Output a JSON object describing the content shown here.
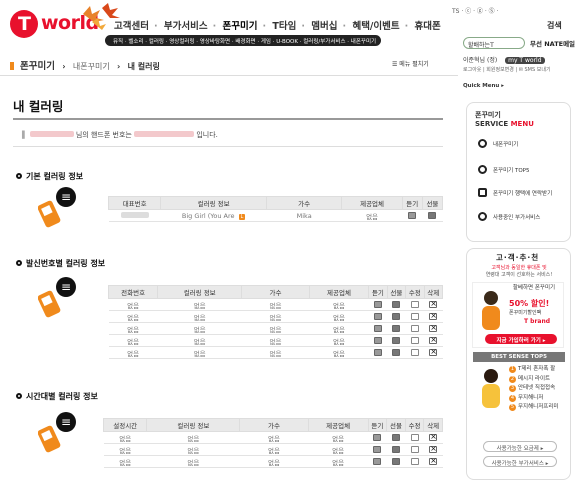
{
  "brand": {
    "name": "world"
  },
  "main_nav": {
    "items": [
      "고객센터",
      "부가서비스",
      "폰꾸미기",
      "T타임",
      "멤버십",
      "혜택/이벤트",
      "휴대폰"
    ],
    "active": "폰꾸미기"
  },
  "sub_nav": {
    "text": "뮤직 · 벨소리 · 컬러링 · 영상컬러링 · 영상바탕화면 · 배경화면 · 게임 · U-BOOK · 컬러링/부가서비스 · 내폰꾸미기"
  },
  "util": {
    "text": "TS · ⓒ · ⓖ · Ⓢ ·",
    "search": "검색"
  },
  "header_buttons": {
    "halin": "할배하는T",
    "natemail": "무선 NATE메일"
  },
  "breadcrumb": {
    "level1": "폰꾸미기",
    "level2": "내폰꾸미기",
    "level3": "내 컬러링"
  },
  "menu_expand": "메뉴 펼치기",
  "user": {
    "name": "이준혁님 (정)",
    "grade": "my T world",
    "links": "로그아웃 | 회원정보변경 | ✉ SMS 보내기",
    "quick_menu": "Quick Menu ▸"
  },
  "page_title": "내 컬러링",
  "notice": {
    "suffix1": "님의 핸드폰 번호는",
    "suffix2": "입니다."
  },
  "section1": {
    "title": "기본 컬러링 정보",
    "headers": [
      "대표번호",
      "컬러링 정보",
      "가수",
      "제공업체",
      "듣기",
      "선물"
    ],
    "rows": [
      {
        "song": "Big Girl (You Are",
        "badge": "L",
        "artist": "Mika",
        "provider": "없음"
      }
    ]
  },
  "section2": {
    "title": "발신번호별 컬러링 정보",
    "headers": [
      "전화번호",
      "컬러링 정보",
      "가수",
      "제공업체",
      "듣기",
      "선물",
      "수정",
      "삭제"
    ],
    "rows": [
      [
        "없음",
        "없음",
        "없음",
        "없음"
      ],
      [
        "없음",
        "없음",
        "없음",
        "없음"
      ],
      [
        "없음",
        "없음",
        "없음",
        "없음"
      ],
      [
        "없음",
        "없음",
        "없음",
        "없음"
      ],
      [
        "없음",
        "없음",
        "없음",
        "없음"
      ]
    ]
  },
  "section3": {
    "title": "시간대별 컬러링 정보",
    "headers": [
      "설정시간",
      "컬러링 정보",
      "가수",
      "제공업체",
      "듣기",
      "선물",
      "수정",
      "삭제"
    ],
    "rows": [
      [
        "없음",
        "없음",
        "없음",
        "없음"
      ],
      [
        "없음",
        "없음",
        "없음",
        "없음"
      ],
      [
        "없음",
        "없음",
        "없음",
        "없음"
      ]
    ]
  },
  "service_menu": {
    "title1": "폰꾸미기",
    "title2": "SERVICE",
    "title3": "MENU",
    "items": [
      "내폰꾸미기",
      "폰꾸미기 TOP5",
      "폰꾸미기 행택에 연락받기",
      "사용중인 부가서비스"
    ]
  },
  "recommend": {
    "title": "고·객·추·천",
    "desc1": "고객님과 동일한 휴대폰 및",
    "desc2": "연령대 고객이 선호하는 서비스!",
    "ad_text": "할베하면 폰꾸미기",
    "ad_percent": "50% 할인!",
    "ad_sub": "폰꾸미기할인팩",
    "ad_brand": "T brand",
    "ad_button": "지금 가입하러 가기 ▸",
    "best_title": "BEST SENSE TOP5",
    "best_items": [
      "T제리 혼자폭 팔",
      "메시지 라이트",
      "안테넷 직접접속",
      "무지해니저",
      "무지해니저프리미"
    ],
    "pill1": "사용가능한 요금제 ▸",
    "pill2": "사용가능한 부가서비스 ▸"
  },
  "colors": {
    "brand_red": "#e8112d",
    "accent_orange": "#f08a1c"
  }
}
